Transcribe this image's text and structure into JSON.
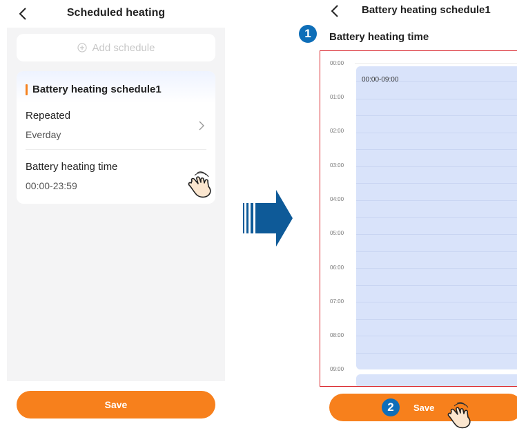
{
  "left_screen": {
    "title": "Scheduled heating",
    "add_schedule_label": "Add schedule",
    "schedule_card": {
      "name": "Battery heating schedule1",
      "repeated_label": "Repeated",
      "repeated_value": "Everday",
      "time_label": "Battery heating time",
      "time_value": "00:00-23:59"
    },
    "save_label": "Save"
  },
  "right_screen": {
    "title": "Battery heating schedule1",
    "subtitle": "Battery heating time",
    "hours": [
      "00:00",
      "01:00",
      "02:00",
      "03:00",
      "04:00",
      "05:00",
      "06:00",
      "07:00",
      "08:00",
      "09:00"
    ],
    "block_label": "00:00-09:00",
    "save_label": "Save"
  },
  "steps": {
    "one": "1",
    "two": "2"
  },
  "icons": [
    "back-arrow-icon",
    "plus-circle-icon",
    "chevron-right-icon",
    "hand-tap-icon",
    "step-arrow-icon"
  ],
  "colors": {
    "accent": "#f7801c",
    "badge": "#0e6eb8",
    "block": "#d9e3fa",
    "highlight_border": "#d9232a"
  }
}
